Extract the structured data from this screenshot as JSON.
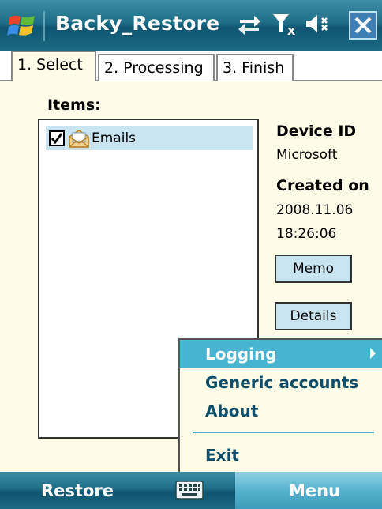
{
  "window": {
    "title": "Backy_Restore",
    "icons": [
      "windows-start-icon",
      "connectivity-icon",
      "no-signal-icon",
      "volume-muted-icon",
      "close-icon"
    ]
  },
  "tabs": [
    {
      "label": "1. Select",
      "active": true
    },
    {
      "label": "2. Processing",
      "active": false
    },
    {
      "label": "3. Finish",
      "active": false
    }
  ],
  "main": {
    "items_label": "Items:",
    "list_items": [
      {
        "label": "Emails",
        "checked": true,
        "icon": "email-icon",
        "selected": true
      }
    ],
    "device_id_label": "Device ID",
    "device_id_value": "Microsoft",
    "created_on_label": "Created on",
    "created_date": "2008.11.06",
    "created_time": "18:26:06",
    "memo_button": "Memo",
    "details_button": "Details"
  },
  "popup_menu": {
    "items": [
      {
        "label": "Logging",
        "highlighted": true,
        "has_submenu": true
      },
      {
        "label": "Generic accounts",
        "highlighted": false
      },
      {
        "label": "About",
        "highlighted": false
      },
      {
        "label": "Exit",
        "highlighted": false
      }
    ]
  },
  "softkeys": {
    "left": "Restore",
    "right": "Menu",
    "center_icon": "keyboard-icon"
  },
  "colors": {
    "titlebar": "#1f6d86",
    "content_bg": "#fffde7",
    "selection": "#c8e4f0",
    "menu_highlight": "#47b4d2",
    "menu_text": "#0d4f6b"
  }
}
